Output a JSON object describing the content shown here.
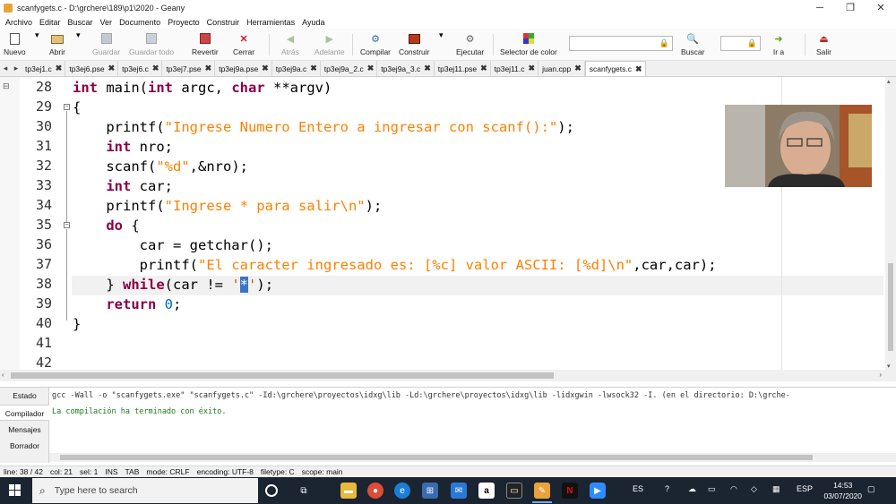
{
  "window": {
    "title": "scanfygets.c - D:\\grchere\\189\\p1\\2020 - Geany",
    "minimize_glyph": "─",
    "maximize_glyph": "❐",
    "close_glyph": "✕"
  },
  "menu": [
    "Archivo",
    "Editar",
    "Buscar",
    "Ver",
    "Documento",
    "Proyecto",
    "Construir",
    "Herramientas",
    "Ayuda"
  ],
  "toolbar": {
    "nuevo": "Nuevo",
    "abrir": "Abrir",
    "guardar": "Guardar",
    "guardar_todo": "Guardar todo",
    "revertir": "Revertir",
    "cerrar": "Cerrar",
    "atras": "Atrás",
    "adelante": "Adelante",
    "compilar": "Compilar",
    "construir": "Construir",
    "ejecutar": "Ejecutar",
    "selector_color": "Selector de color",
    "buscar": "Buscar",
    "ir_a": "Ir a",
    "salir": "Salir",
    "search_value": "",
    "goto_value": ""
  },
  "tabs": [
    {
      "label": "tp3ej1.c",
      "active": false
    },
    {
      "label": "tp3ej6.pse",
      "active": false
    },
    {
      "label": "tp3ej6.c",
      "active": false
    },
    {
      "label": "tp3ej7.pse",
      "active": false
    },
    {
      "label": "tp3ej9a.pse",
      "active": false
    },
    {
      "label": "tp3ej9a.c",
      "active": false
    },
    {
      "label": "tp3ej9a_2.c",
      "active": false
    },
    {
      "label": "tp3ej9a_3.c",
      "active": false
    },
    {
      "label": "tp3ej11.pse",
      "active": false
    },
    {
      "label": "tp3ej11.c",
      "active": false
    },
    {
      "label": "juan.cpp",
      "active": false
    },
    {
      "label": "scanfygets.c",
      "active": true
    }
  ],
  "editor": {
    "line_numbers": [
      "28",
      "29",
      "30",
      "31",
      "32",
      "33",
      "34",
      "35",
      "36",
      "37",
      "38",
      "39",
      "40",
      "41",
      "42"
    ],
    "code": {
      "l28_kw1": "int",
      "l28_a": " main(",
      "l28_kw2": "int",
      "l28_b": " argc, ",
      "l28_kw3": "char",
      "l28_c": " **argv)",
      "l29": "{",
      "l30_a": "    printf(",
      "l30_str": "\"Ingrese Numero Entero a ingresar con scanf():\"",
      "l30_b": ");",
      "l31_kw": "int",
      "l31_a": " nro;",
      "l32_a": "    scanf(",
      "l32_str": "\"%d\"",
      "l32_b": ",&nro);",
      "l33_kw": "int",
      "l33_a": " car;",
      "l34_a": "    printf(",
      "l34_str": "\"Ingrese * para salir\\n\"",
      "l34_b": ");",
      "l35_kw": "do",
      "l35_a": " {",
      "l36": "        car = getchar();",
      "l37_a": "        printf(",
      "l37_str": "\"El caracter ingresado es: [%c] valor ASCII: [%d]\\n\"",
      "l37_b": ",car,car);",
      "l38_a": "    } ",
      "l38_kw": "while",
      "l38_b": "(car != ",
      "l38_q1": "'",
      "l38_sel": "*",
      "l38_q2": "'",
      "l38_c": ");",
      "l39_kw": "return",
      "l39_num": "0",
      "l39_a": ";",
      "l40": "}"
    }
  },
  "messages": {
    "tabs": [
      "Estado",
      "Compilador",
      "Mensajes",
      "Borrador"
    ],
    "active_tab": "Compilador",
    "lines": [
      "gcc -Wall -o \"scanfygets.exe\" \"scanfygets.c\" -Id:\\grchere\\proyectos\\idxg\\lib -Ld:\\grchere\\proyectos\\idxg\\lib -lidxgwin -lwsock32 -I. (en el directorio: D:\\grche-",
      "La compilación ha terminado con éxito."
    ]
  },
  "statusbar": {
    "line": "line: 38 / 42",
    "col": "col: 21",
    "sel": "sel: 1",
    "ins": "INS",
    "tab": "TAB",
    "mode": "mode: CRLF",
    "encoding": "encoding: UTF-8",
    "filetype": "filetype: C",
    "scope": "scope: main"
  },
  "taskbar": {
    "search_placeholder": "Type here to search",
    "lang": "ES",
    "input_lang": "ESP",
    "time": "14:53",
    "date": "03/07/2020"
  },
  "colors": {
    "keyword": "#8b0045",
    "string": "#ff7f00",
    "number": "#006bb5",
    "selection": "#3a74c7",
    "taskbar": "#1b2431"
  }
}
